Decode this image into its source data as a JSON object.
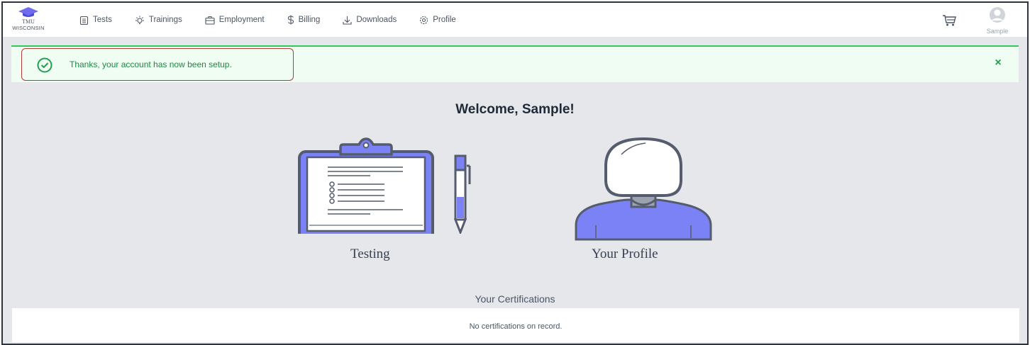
{
  "brand": {
    "line1": "TMU",
    "line2": "WISCONSIN"
  },
  "nav": {
    "items": [
      {
        "label": "Tests",
        "icon": "clipboard-icon"
      },
      {
        "label": "Trainings",
        "icon": "lightbulb-icon"
      },
      {
        "label": "Employment",
        "icon": "briefcase-icon"
      },
      {
        "label": "Billing",
        "icon": "dollar-icon"
      },
      {
        "label": "Downloads",
        "icon": "download-icon"
      },
      {
        "label": "Profile",
        "icon": "gear-icon"
      }
    ],
    "cart_icon": "cart-icon",
    "user": {
      "name": "Sample",
      "icon": "user-avatar-icon"
    }
  },
  "alert": {
    "message": "Thanks, your account has now been setup.",
    "close_symbol": "×",
    "icon": "check-circle-icon",
    "color": "#1f8a45"
  },
  "welcome": "Welcome, Sample!",
  "cards": [
    {
      "label": "Testing",
      "icon": "clipboard-pen-illustration"
    },
    {
      "label": "Your Profile",
      "icon": "person-illustration"
    }
  ],
  "certifications": {
    "title": "Your Certifications",
    "empty_message": "No certifications on record."
  },
  "colors": {
    "accent": "#7b82f5",
    "success": "#34c759",
    "frame": "#2d3440"
  }
}
